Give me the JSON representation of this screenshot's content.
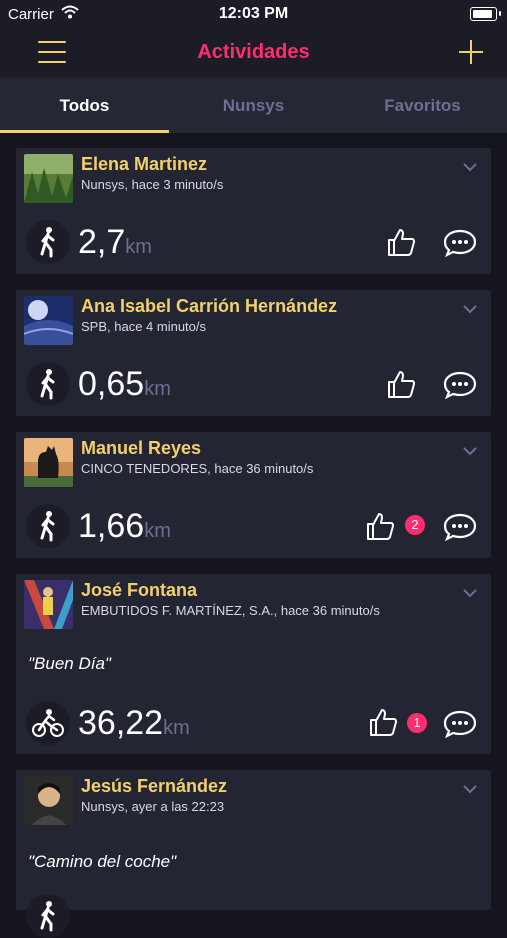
{
  "status_bar": {
    "carrier": "Carrier",
    "time": "12:03 PM"
  },
  "header": {
    "title": "Actividades"
  },
  "tabs": [
    {
      "label": "Todos",
      "active": true
    },
    {
      "label": "Nunsys",
      "active": false
    },
    {
      "label": "Favoritos",
      "active": false
    }
  ],
  "activities": [
    {
      "name": "Elena Martinez",
      "subtitle": "Nunsys, hace 3 minuto/s",
      "quote": "",
      "distance": "2,7",
      "unit": "km",
      "activity_icon": "walking-icon",
      "likes_badge": ""
    },
    {
      "name": "Ana Isabel  Carrión Hernández",
      "subtitle": "SPB, hace 4 minuto/s",
      "quote": "",
      "distance": "0,65",
      "unit": "km",
      "activity_icon": "walking-icon",
      "likes_badge": ""
    },
    {
      "name": "Manuel Reyes",
      "subtitle": "CINCO TENEDORES, hace 36 minuto/s",
      "quote": "",
      "distance": "1,66",
      "unit": "km",
      "activity_icon": "walking-icon",
      "likes_badge": "2"
    },
    {
      "name": "José  Fontana",
      "subtitle": "EMBUTIDOS F. MARTÍNEZ, S.A., hace 36 minuto/s",
      "quote": "\"Buen Día\"",
      "distance": "36,22",
      "unit": "km",
      "activity_icon": "cycling-icon",
      "likes_badge": "1"
    },
    {
      "name": "Jesús Fernández",
      "subtitle": "Nunsys, ayer a las 22:23",
      "quote": "\"Camino del coche\"",
      "distance": "",
      "unit": "",
      "activity_icon": "walking-icon",
      "likes_badge": ""
    }
  ],
  "colors": {
    "accent_yellow": "#f2d06b",
    "accent_pink": "#ff2d6f",
    "card_bg": "#232532",
    "muted": "#6d6f93"
  }
}
